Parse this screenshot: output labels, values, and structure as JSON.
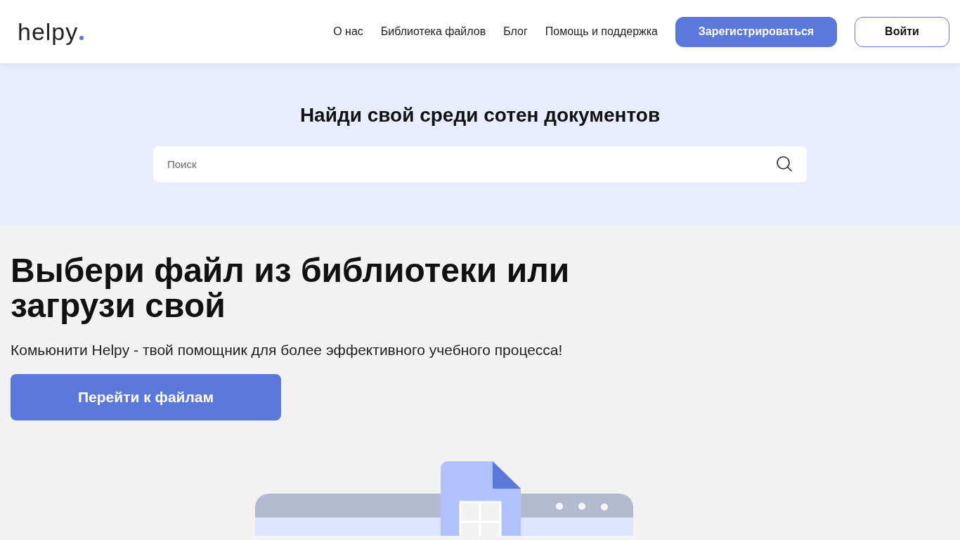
{
  "header": {
    "logo": "helpy",
    "nav": [
      {
        "label": "О нас"
      },
      {
        "label": "Библиотека файлов"
      },
      {
        "label": "Блог"
      },
      {
        "label": "Помощь и поддержка"
      }
    ],
    "register_button": "Зарегистрироваться",
    "login_button": "Войти"
  },
  "search_section": {
    "title": "Найди свой среди сотен документов",
    "search": {
      "placeholder": "Поиск"
    }
  },
  "hero": {
    "title": "Выбери файл из библиотеки или загрузи свой",
    "subtitle": "Комьюнити Helpy - твой помощник для более эффективного учебного процесса!",
    "button": "Перейти к файлам"
  }
}
